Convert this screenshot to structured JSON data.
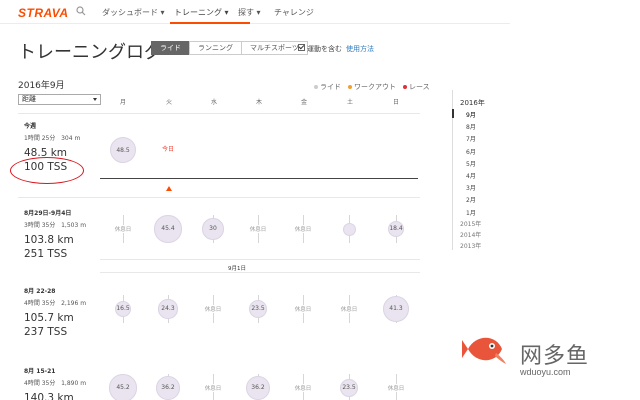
{
  "nav": {
    "logo": "STRAVA",
    "items": [
      {
        "label": "ダッシュボード ▾"
      },
      {
        "label": "トレーニング ▾"
      },
      {
        "label": "探す ▾"
      },
      {
        "label": "チャレンジ"
      }
    ]
  },
  "page": {
    "title": "トレーニングログ",
    "tabs": [
      "ライド",
      "ランニング",
      "マルチスポーツ"
    ],
    "active_tab": "ライド",
    "checkbox_label": "運動を含む",
    "checkbox_checked": true,
    "howto_link": "使用方法",
    "month_label": "2016年9月",
    "select_value": "距離"
  },
  "legend": [
    {
      "label": "ライド",
      "color": "#cccccc"
    },
    {
      "label": "ワークアウト",
      "color": "#f0a030"
    },
    {
      "label": "レース",
      "color": "#e0303a"
    }
  ],
  "day_headers": [
    "月",
    "火",
    "水",
    "木",
    "金",
    "土",
    "日"
  ],
  "today_label": "今日",
  "month_separator": "9月1日",
  "rest_label": "休息日",
  "weeks": [
    {
      "label": "今週",
      "time": "1時間 25分",
      "elev": "304 m",
      "distance": "48.5 km",
      "tss": "100 TSS",
      "days": [
        "48.5",
        null,
        null,
        null,
        null,
        null,
        null
      ]
    },
    {
      "label": "8月29日-9月4日",
      "time": "3時間 35分",
      "elev": "1,503 m",
      "distance": "103.8 km",
      "tss": "251 TSS",
      "days": [
        "rest",
        "45.4",
        "30",
        "rest",
        "rest",
        "",
        "18.4"
      ]
    },
    {
      "label": "8月 22-28",
      "time": "4時間 35分",
      "elev": "2,196 m",
      "distance": "105.7 km",
      "tss": "237 TSS",
      "days": [
        "16.5",
        "24.3",
        "rest",
        "23.5",
        "rest",
        "rest",
        "41.3"
      ]
    },
    {
      "label": "8月 15-21",
      "time": "4時間 35分",
      "elev": "1,890 m",
      "distance": "140.3 km",
      "tss": "",
      "days": [
        "45.2",
        "36.2",
        "rest",
        "36.2",
        "rest",
        "23.5",
        "rest"
      ]
    }
  ],
  "sidebar": {
    "current_year": "2016年",
    "months": [
      "9月",
      "8月",
      "7月",
      "6月",
      "5月",
      "4月",
      "3月",
      "2月",
      "1月"
    ],
    "active_month": "9月",
    "years": [
      "2015年",
      "2014年",
      "2013年"
    ]
  },
  "watermark": {
    "text": "网多鱼",
    "url": "wduoyu.com",
    "fish_color": "#e8553a"
  }
}
